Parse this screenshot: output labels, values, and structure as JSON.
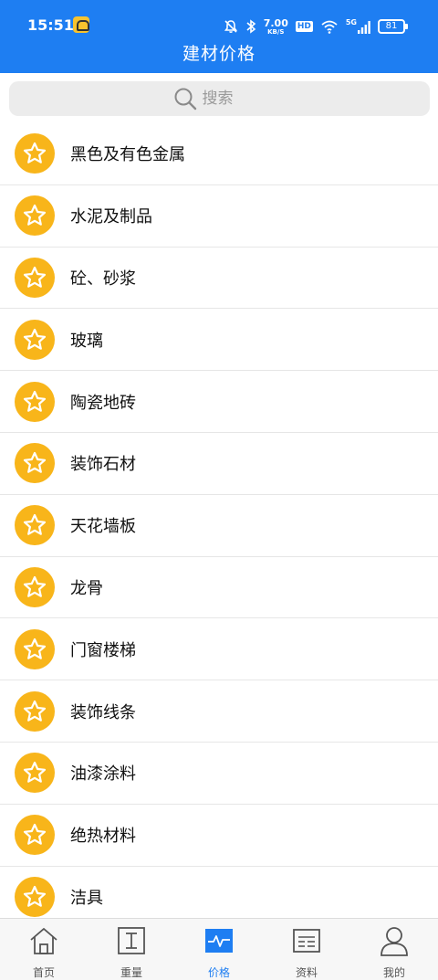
{
  "status_bar": {
    "time": "15:51",
    "speed_value": "7.00",
    "speed_unit": "KB/S",
    "hd": "HD",
    "network": "5G",
    "battery": "81"
  },
  "header": {
    "title": "建材价格"
  },
  "search": {
    "placeholder": "搜索"
  },
  "categories": [
    {
      "label": "黑色及有色金属"
    },
    {
      "label": "水泥及制品"
    },
    {
      "label": "砼、砂浆"
    },
    {
      "label": "玻璃"
    },
    {
      "label": "陶瓷地砖"
    },
    {
      "label": "装饰石材"
    },
    {
      "label": "天花墙板"
    },
    {
      "label": "龙骨"
    },
    {
      "label": "门窗楼梯"
    },
    {
      "label": "装饰线条"
    },
    {
      "label": "油漆涂料"
    },
    {
      "label": "绝热材料"
    },
    {
      "label": "洁具"
    }
  ],
  "tabs": [
    {
      "label": "首页",
      "icon": "home-icon",
      "active": false
    },
    {
      "label": "重量",
      "icon": "weight-icon",
      "active": false
    },
    {
      "label": "价格",
      "icon": "price-chart-icon",
      "active": true
    },
    {
      "label": "资料",
      "icon": "document-icon",
      "active": false
    },
    {
      "label": "我的",
      "icon": "user-icon",
      "active": false
    }
  ],
  "colors": {
    "header": "#1e7ef2",
    "accent": "#1e7ef2",
    "star_badge": "#f8b51a"
  }
}
